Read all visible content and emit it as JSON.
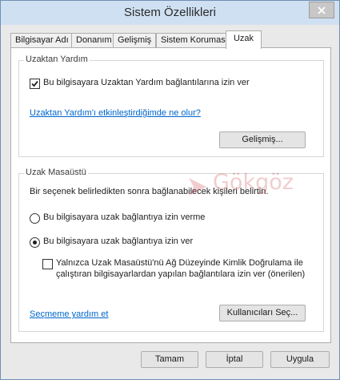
{
  "window": {
    "title": "Sistem Özellikleri",
    "close_icon": "close-icon"
  },
  "tabs": [
    {
      "label": "Bilgisayar Adı",
      "active": false
    },
    {
      "label": "Donanım",
      "active": false
    },
    {
      "label": "Gelişmiş",
      "active": false
    },
    {
      "label": "Sistem Koruması",
      "active": false
    },
    {
      "label": "Uzak",
      "active": true
    }
  ],
  "remote_assistance": {
    "group_label": "Uzaktan Yardım",
    "allow_checkbox": {
      "label": "Bu bilgisayara Uzaktan Yardım bağlantılarına izin ver",
      "checked": true
    },
    "help_link": "Uzaktan Yardım'ı etkinleştirdiğimde ne olur?",
    "advanced_button": "Gelişmiş..."
  },
  "remote_desktop": {
    "group_label": "Uzak Masaüstü",
    "description": "Bir seçenek belirledikten sonra bağlanabilecek kişileri belirtin.",
    "options": [
      {
        "label": "Bu bilgisayara uzak bağlantıya izin verme",
        "selected": false
      },
      {
        "label": "Bu bilgisayara uzak bağlantıya izin ver",
        "selected": true
      }
    ],
    "nla_checkbox": {
      "line1": "Yalnızca Uzak Masaüstü'nü Ağ Düzeyinde Kimlik Doğrulama ile",
      "line2": "çalıştıran bilgisayarlardan yapılan bağlantılara izin ver (önerilen)",
      "checked": false
    },
    "help_link": "Seçmeme yardım et",
    "select_users_button": "Kullanıcıları Seç..."
  },
  "footer": {
    "ok": "Tamam",
    "cancel": "İptal",
    "apply": "Uygula"
  },
  "watermark": {
    "text": "Gökgöz",
    "color": "#c0202a"
  }
}
